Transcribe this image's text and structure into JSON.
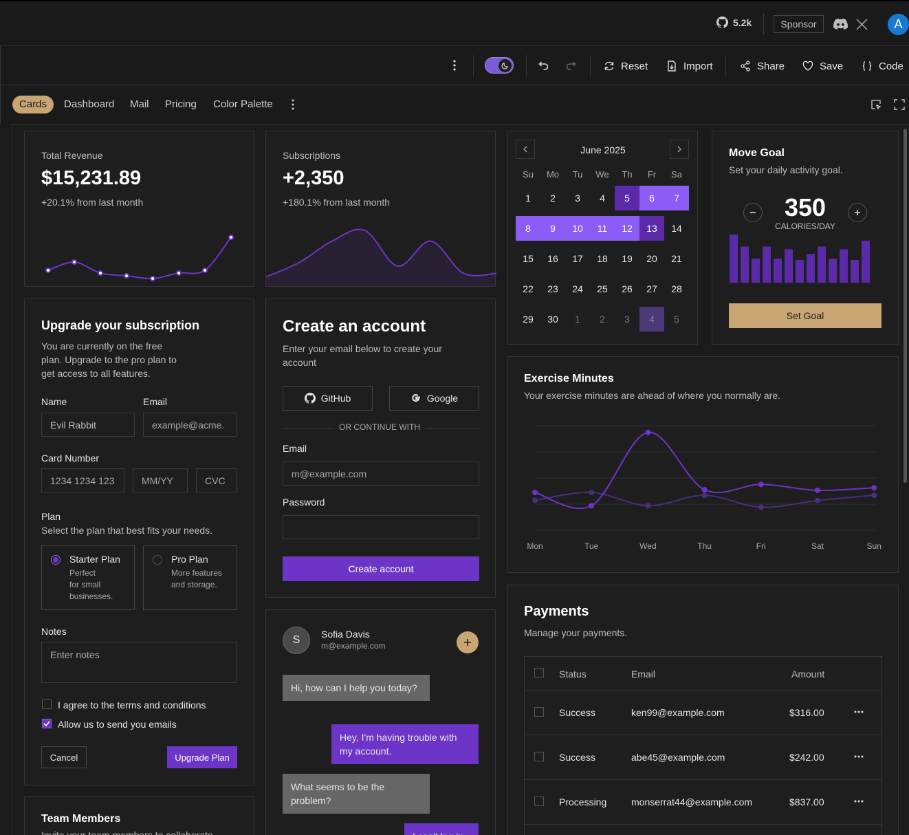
{
  "topbar": {
    "github_stars": "5.2k",
    "sponsor_label": "Sponsor",
    "avatar_letter": "A"
  },
  "toolbar": {
    "reset_label": "Reset",
    "import_label": "Import",
    "share_label": "Share",
    "save_label": "Save",
    "code_label": "Code"
  },
  "tabs": [
    "Cards",
    "Dashboard",
    "Mail",
    "Pricing",
    "Color Palette"
  ],
  "colors": {
    "accent": "#6c35c7",
    "accent_light": "#8b5cf6",
    "gold": "#c9a574"
  },
  "revenue": {
    "title": "Total Revenue",
    "value": "$15,231.89",
    "change": "+20.1% from last month",
    "chart_data": {
      "type": "line",
      "values": [
        10,
        13,
        9,
        8,
        7,
        9,
        10,
        22
      ]
    }
  },
  "subscriptions": {
    "title": "Subscriptions",
    "value": "+2,350",
    "change": "+180.1% from last month",
    "chart_data": {
      "type": "area",
      "values": [
        2,
        6,
        12,
        15,
        5,
        12,
        3,
        3
      ]
    }
  },
  "calendar": {
    "month": "June 2025",
    "weekdays": [
      "Su",
      "Mo",
      "Tu",
      "We",
      "Th",
      "Fr",
      "Sa"
    ],
    "days": [
      "1",
      "2",
      "3",
      "4",
      "5",
      "6",
      "7",
      "8",
      "9",
      "10",
      "11",
      "12",
      "13",
      "14",
      "15",
      "16",
      "17",
      "18",
      "19",
      "20",
      "21",
      "22",
      "23",
      "24",
      "25",
      "26",
      "27",
      "28",
      "29",
      "30",
      "1",
      "2",
      "3",
      "4",
      "5"
    ],
    "selected_range": "June 5 - June 13",
    "today": "July 4"
  },
  "move_goal": {
    "title": "Move Goal",
    "subtitle": "Set your daily activity goal.",
    "value": "350",
    "unit": "CALORIES/DAY",
    "button": "Set Goal",
    "chart_data": {
      "type": "bar",
      "values": [
        400,
        300,
        200,
        300,
        200,
        278,
        189,
        239,
        300,
        200,
        278,
        189,
        349
      ]
    }
  },
  "subscription_form": {
    "title": "Upgrade your subscription",
    "description": "You are currently on the free plan. Upgrade to the pro plan to get access to all features.",
    "name_label": "Name",
    "name_value": "Evil Rabbit",
    "email_label": "Email",
    "email_placeholder": "example@acme.",
    "card_label": "Card Number",
    "card_placeholder": "1234 1234 123",
    "expiry_placeholder": "MM/YY",
    "cvc_placeholder": "CVC",
    "plan_label": "Plan",
    "plan_desc": "Select the plan that best fits your needs.",
    "starter_title": "Starter Plan",
    "starter_desc_1": "Perfect",
    "starter_desc_2": "for small",
    "starter_desc_3": "businesses.",
    "pro_title": "Pro Plan",
    "pro_desc_1": "More features",
    "pro_desc_2": "and storage.",
    "notes_label": "Notes",
    "notes_placeholder": "Enter notes",
    "terms_label": "I agree to the terms and conditions",
    "emails_label": "Allow us to send you emails",
    "cancel_label": "Cancel",
    "upgrade_label": "Upgrade Plan"
  },
  "create_account": {
    "title": "Create an account",
    "description": "Enter your email below to create your account",
    "github_label": "GitHub",
    "google_label": "Google",
    "divider": "OR CONTINUE WITH",
    "email_label": "Email",
    "email_placeholder": "m@example.com",
    "password_label": "Password",
    "submit_label": "Create account"
  },
  "chat": {
    "avatar": "S",
    "name": "Sofia Davis",
    "email": "m@example.com",
    "messages": [
      "Hi, how can I help you today?",
      "Hey, I'm having trouble with my account.",
      "What seems to be the problem?",
      "I can't log in."
    ]
  },
  "exercise": {
    "title": "Exercise Minutes",
    "subtitle": "Your exercise minutes are ahead of where you normally are.",
    "chart_data": {
      "type": "line",
      "categories": [
        "Mon",
        "Tue",
        "Wed",
        "Thu",
        "Fri",
        "Sat",
        "Sun"
      ],
      "series": [
        {
          "values": [
            240,
            300,
            200,
            278,
            189,
            239,
            278
          ]
        },
        {
          "values": [
            300,
            200,
            750,
            320,
            360,
            315,
            335
          ]
        }
      ]
    }
  },
  "payments": {
    "title": "Payments",
    "subtitle": "Manage your payments.",
    "headers": {
      "status": "Status",
      "email": "Email",
      "amount": "Amount"
    },
    "rows": [
      {
        "status": "Success",
        "email": "ken99@example.com",
        "amount": "$316.00"
      },
      {
        "status": "Success",
        "email": "abe45@example.com",
        "amount": "$242.00"
      },
      {
        "status": "Processing",
        "email": "monserrat44@example.com",
        "amount": "$837.00"
      }
    ]
  },
  "team": {
    "title": "Team Members",
    "subtitle": "Invite your team members to collaborate."
  }
}
